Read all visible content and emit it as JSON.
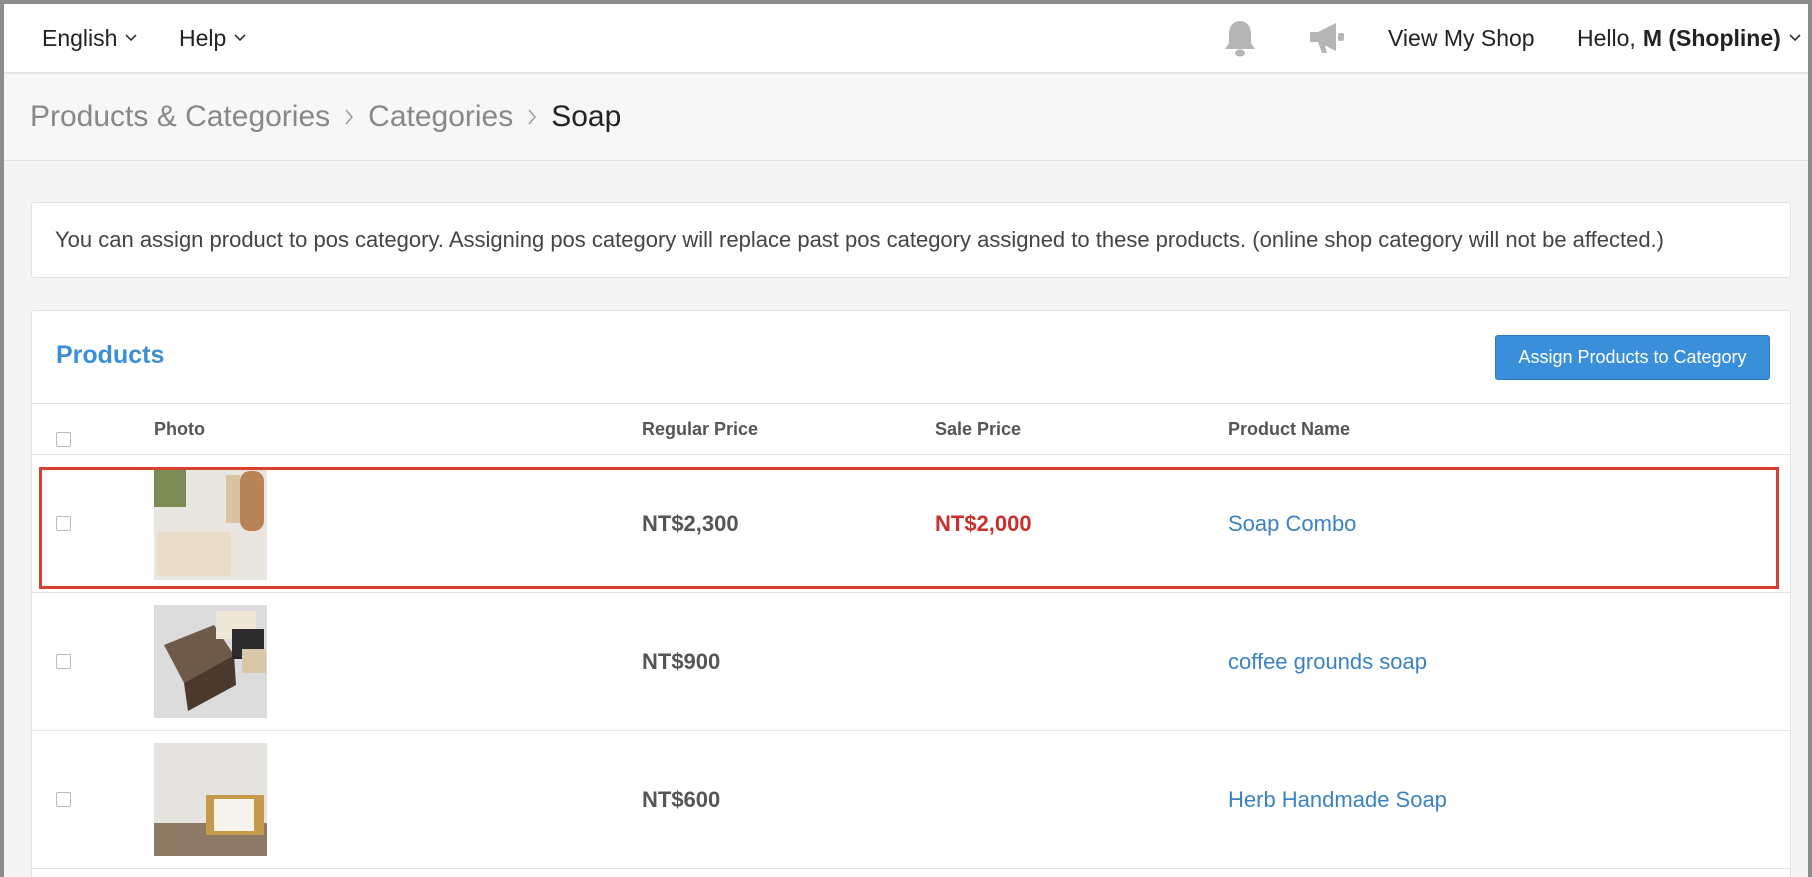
{
  "nav": {
    "language": "English",
    "help": "Help",
    "view_shop": "View My Shop",
    "hello_prefix": "Hello,",
    "user": "M (Shopline)",
    "icons": [
      "bell-icon",
      "megaphone-icon",
      "chevron-down-icon"
    ]
  },
  "breadcrumb": {
    "items": [
      "Products & Categories",
      "Categories",
      "Soap"
    ],
    "separator": ">"
  },
  "info": {
    "text": "You can assign product to pos category. Assigning pos category will replace past pos category assigned to these products. (online shop category will not be affected.)"
  },
  "products": {
    "title": "Products",
    "assign_button": "Assign Products to Category",
    "columns": [
      "Photo",
      "Regular Price",
      "Sale Price",
      "Product Name"
    ],
    "rows": [
      {
        "regular_price": "NT$2,300",
        "sale_price": "NT$2,000",
        "name": "Soap Combo",
        "highlighted": true
      },
      {
        "regular_price": "NT$900",
        "sale_price": "",
        "name": "coffee grounds soap",
        "highlighted": false
      },
      {
        "regular_price": "NT$600",
        "sale_price": "",
        "name": "Herb Handmade Soap",
        "highlighted": false
      }
    ]
  },
  "colors": {
    "link": "#3b82c4",
    "title": "#3b8fd6",
    "button": "#3a8fdb",
    "sale": "#c9302c",
    "highlight": "#d9402f"
  }
}
